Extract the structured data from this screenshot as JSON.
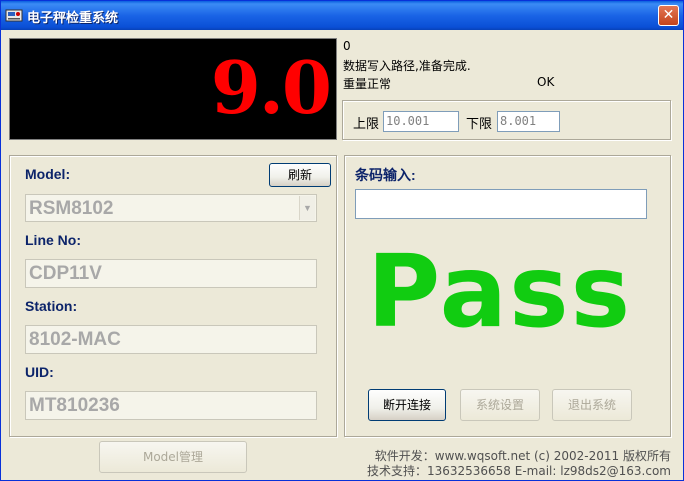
{
  "window": {
    "title": "电子秤检重系统",
    "close_glyph": "✕"
  },
  "display": {
    "weight": "9.0"
  },
  "status": {
    "line1": "0",
    "line2": "数据写入路径,准备完成.",
    "line3": "重量正常",
    "ok": "OK"
  },
  "limits": {
    "upper_label": "上限",
    "upper_value": "10.001",
    "lower_label": "下限",
    "lower_value": "8.001"
  },
  "left": {
    "model_label": "Model:",
    "refresh_label": "刷新",
    "model_value": "RSM8102",
    "line_label": "Line No:",
    "line_value": "CDP11V",
    "station_label": "Station:",
    "station_value": "8102-MAC",
    "uid_label": "UID:",
    "uid_value": "MT810236"
  },
  "right": {
    "barcode_label": "条码输入:",
    "barcode_value": "",
    "result": "Pass",
    "disconnect_label": "断开连接",
    "settings_label": "系统设置",
    "exit_label": "退出系统"
  },
  "bottom": {
    "model_mgmt_label": "Model管理"
  },
  "footer": {
    "developer": "软件开发：www.wqsoft.net (c) 2002-2011 版权所有",
    "support": "技术支持：13632536658 E-mail: lz98ds2@163.com"
  },
  "colors": {
    "display_digits": "#ff0000",
    "pass_text": "#11cc11",
    "label_blue": "#0c246a",
    "titlebar": "#1a64e6"
  }
}
